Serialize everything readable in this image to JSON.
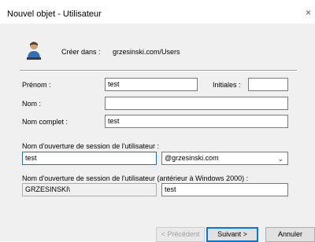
{
  "window": {
    "title": "Nouvel objet - Utilisateur",
    "close_glyph": "×"
  },
  "header": {
    "create_in_label": "Créer dans :",
    "create_in_value": "grzesinski.com/Users"
  },
  "form": {
    "first_name": {
      "label": "Prénom :",
      "value": "test"
    },
    "initials": {
      "label": "Initiales :",
      "value": ""
    },
    "last_name": {
      "label": "Nom :",
      "value": ""
    },
    "full_name": {
      "label": "Nom complet :",
      "value": "test"
    },
    "logon_name": {
      "label": "Nom d'ouverture de session de l'utilisateur :",
      "value": "test",
      "domain": "@grzesinski.com",
      "arrow": "⌄"
    },
    "legacy_logon": {
      "label": "Nom d'ouverture de session de l'utilisateur (antérieur à Windows 2000) :",
      "domain_prefix": "GRZESINSKI\\",
      "value": "test"
    }
  },
  "buttons": {
    "previous": "< Précédent",
    "next": "Suivant >",
    "cancel": "Annuler"
  },
  "colors": {
    "focus_border": "#0078d7",
    "dialog_bg": "#f0f0f0"
  },
  "icons": {
    "header_icon": "user-icon",
    "close": "close-icon"
  }
}
